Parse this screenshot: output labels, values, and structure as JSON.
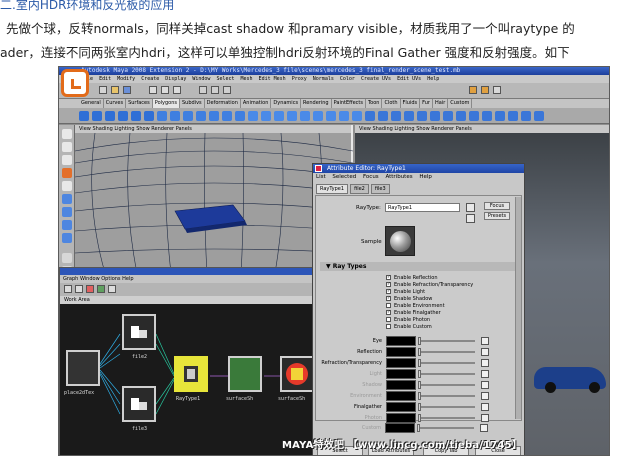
{
  "article": {
    "heading": "二.室内HDR环境和反光板的应用",
    "para_line1": "先做个球，反转normals，同样关掉cast shadow 和pramary visible，材质我用了一个叫raytype 的",
    "para_line2": "ader，连接不同两张室内hdri，这样可以单独控制hdri反射环境的Final Gather 强度和反射强度。如下"
  },
  "maya": {
    "title": "Autodesk Maya 2008 Extension 2 - D:\\MY Works\\Mercedes_3 file\\scenes\\mercedes_3 final_render_scene_test.mb",
    "menu": [
      "File",
      "Edit",
      "Modify",
      "Create",
      "Display",
      "Window",
      "Select",
      "Mesh",
      "Edit Mesh",
      "Proxy",
      "Normals",
      "Color",
      "Create UVs",
      "Edit UVs",
      "Help"
    ],
    "shelf_tabs": [
      "General",
      "Curves",
      "Surfaces",
      "Polygons",
      "Subdivs",
      "Deformation",
      "Animation",
      "Dynamics",
      "Rendering",
      "PaintEffects",
      "Toon",
      "Cloth",
      "Fluids",
      "Fur",
      "Hair",
      "Custom"
    ],
    "active_shelf": "Polygons",
    "viewport_menu": [
      "View",
      "Shading",
      "Lighting",
      "Show",
      "Renderer",
      "Panels"
    ],
    "hypergraph_menu": [
      "Graph",
      "Window",
      "Options",
      "Help"
    ],
    "work_area": "Work Area",
    "nodes": [
      {
        "label": "place2dTex"
      },
      {
        "label": "file2"
      },
      {
        "label": "file3"
      },
      {
        "label": "RayType1"
      },
      {
        "label": "surfaceSh"
      },
      {
        "label": "surfaceSh"
      }
    ]
  },
  "attribute_editor": {
    "title": "Attribute Editor: RayType1",
    "menu": [
      "List",
      "Selected",
      "Focus",
      "Attributes",
      "Help"
    ],
    "tabs": [
      "RayType1",
      "file2",
      "file3"
    ],
    "raytype_label": "RayType:",
    "raytype_value": "RayType1",
    "focus_label": "Focus",
    "presets_label": "Presets",
    "sample_label": "Sample",
    "section_title": "Ray Types",
    "checkboxes": [
      {
        "label": "Enable Reflection",
        "checked": true
      },
      {
        "label": "Enable Refraction/Transparency",
        "checked": true
      },
      {
        "label": "Enable Light",
        "checked": true
      },
      {
        "label": "Enable Shadow",
        "checked": true
      },
      {
        "label": "Enable Environment",
        "checked": false
      },
      {
        "label": "Enable Finalgather",
        "checked": true
      },
      {
        "label": "Enable Photon",
        "checked": false
      },
      {
        "label": "Enable Custom",
        "checked": false
      }
    ],
    "attrs": [
      {
        "label": "Eye",
        "dim": false
      },
      {
        "label": "Reflection",
        "dim": false
      },
      {
        "label": "Refraction/Transparency",
        "dim": false
      },
      {
        "label": "Light",
        "dim": true
      },
      {
        "label": "Shadow",
        "dim": true
      },
      {
        "label": "Environment",
        "dim": true
      },
      {
        "label": "Finalgather",
        "dim": false
      },
      {
        "label": "Photon",
        "dim": true
      },
      {
        "label": "Custom",
        "dim": true
      }
    ],
    "buttons": [
      "Select",
      "Load Attributes",
      "Copy Tab",
      "Close"
    ]
  },
  "watermark": "MAYA特效吧 【www.lincg.com/tieba/1745】",
  "colors": {
    "heading_blue": "#2b5aa8",
    "maya_title_blue": "#2c55b8",
    "logo_orange": "#e26b1a"
  }
}
